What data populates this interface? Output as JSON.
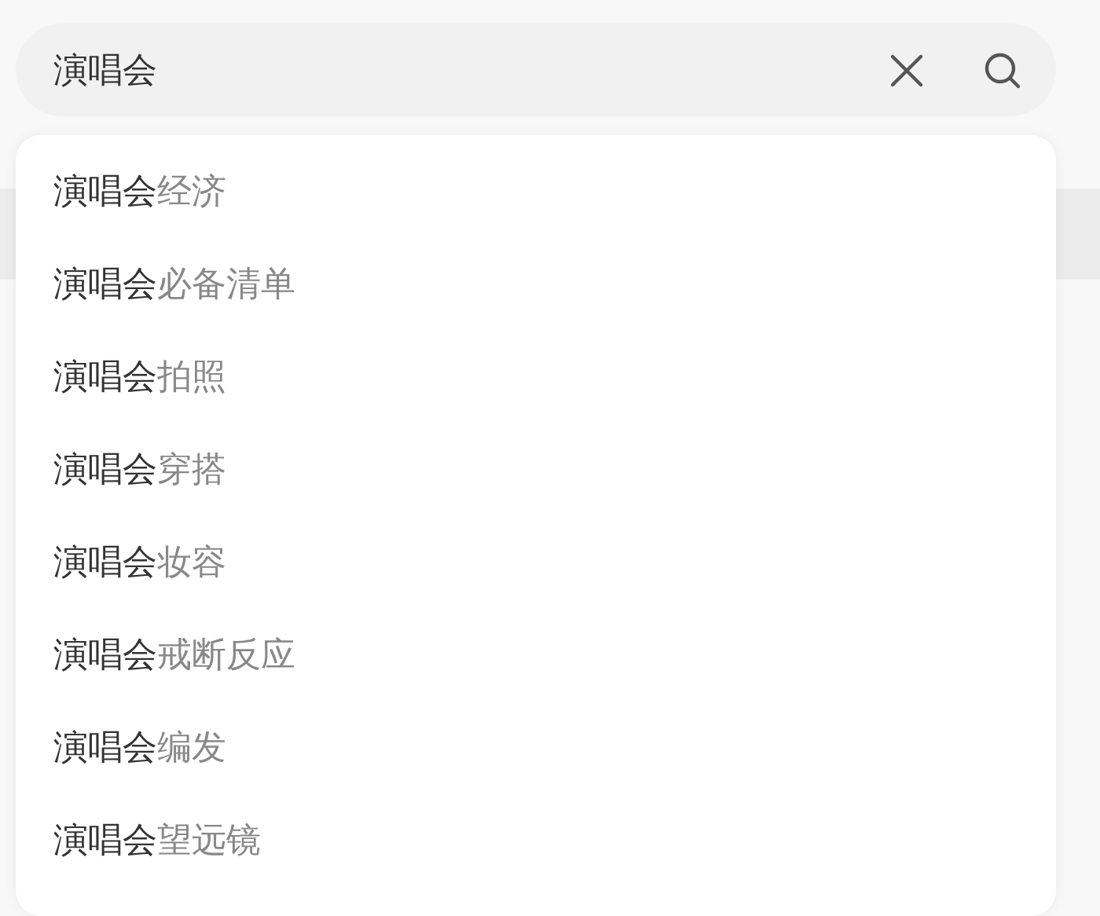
{
  "search": {
    "value": "演唱会"
  },
  "suggestions": [
    {
      "match": "演唱会",
      "rest": "经济"
    },
    {
      "match": "演唱会",
      "rest": "必备清单"
    },
    {
      "match": "演唱会",
      "rest": "拍照"
    },
    {
      "match": "演唱会",
      "rest": "穿搭"
    },
    {
      "match": "演唱会",
      "rest": "妆容"
    },
    {
      "match": "演唱会",
      "rest": "戒断反应"
    },
    {
      "match": "演唱会",
      "rest": "编发"
    },
    {
      "match": "演唱会",
      "rest": "望远镜"
    }
  ]
}
